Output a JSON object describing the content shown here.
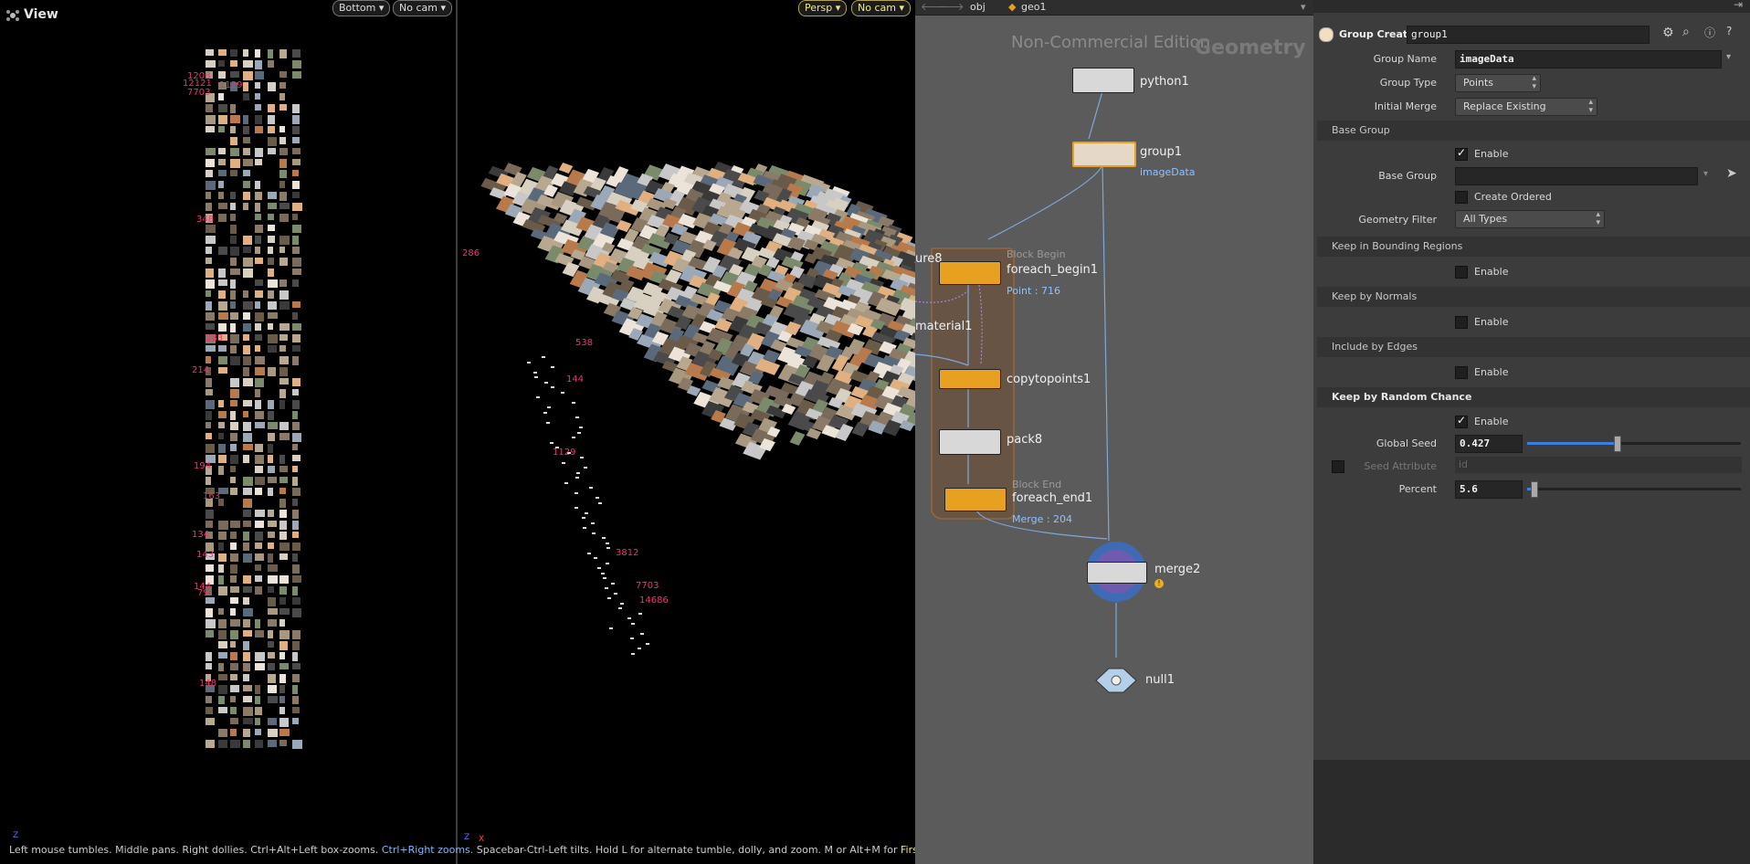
{
  "viewport": {
    "title": "View",
    "left_pane": {
      "view_menu": "Bottom",
      "cam_menu": "No cam"
    },
    "right_pane": {
      "view_menu": "Persp",
      "cam_menu": "No cam"
    },
    "left_labels": [
      "1208",
      "12121",
      "7703",
      "1129",
      "348",
      "283",
      "214",
      "194",
      "163",
      "134",
      "143",
      "144",
      "79",
      "148"
    ],
    "right_labels": [
      "286",
      "3812",
      "7703",
      "14686",
      "1129",
      "144",
      "538"
    ],
    "axis_left": "Z",
    "axis_right": "X",
    "hint": {
      "part1": "Left mouse tumbles. Middle pans. Right dollies. Ctrl+Alt+Left box-zooms. ",
      "part2": "Ctrl+Right zooms. ",
      "part3": "Spacebar-Ctrl-Left tilts. Hold L for alternate tumble, dolly, and zoom. M or Alt+M for ",
      "part4": "First Person Navigation."
    }
  },
  "network": {
    "path": [
      "obj",
      "geo1"
    ],
    "watermark_a": "Non-Commercial Edition",
    "watermark_b": "Geometry",
    "nodes": {
      "python1": {
        "name": "python1"
      },
      "group1": {
        "name": "group1",
        "sub": "imageData"
      },
      "foreach_begin1": {
        "header": "Block Begin",
        "name": "foreach_begin1",
        "sub": "Point : 716"
      },
      "copytopoints1": {
        "name": "copytopoints1"
      },
      "pack8": {
        "name": "pack8"
      },
      "foreach_end1": {
        "header": "Block End",
        "name": "foreach_end1",
        "sub": "Merge : 204"
      },
      "merge2": {
        "name": "merge2"
      },
      "null1": {
        "name": "null1"
      },
      "partial_a": {
        "name": "ure8"
      },
      "partial_b": {
        "name": "material1"
      }
    },
    "colors": {
      "orange": "#e8a020",
      "wire": "#7fa8d8",
      "block": "#8a5a2a"
    }
  },
  "params": {
    "node_type": "Group Create",
    "node_name": "group1",
    "group_name_label": "Group Name",
    "group_name_value": "imageData",
    "group_type_label": "Group Type",
    "group_type_value": "Points",
    "initial_merge_label": "Initial Merge",
    "initial_merge_value": "Replace Existing",
    "base_group_section": "Base Group",
    "enable_label": "Enable",
    "base_group_label": "Base Group",
    "create_ordered_label": "Create Ordered",
    "geometry_filter_label": "Geometry Filter",
    "geometry_filter_value": "All Types",
    "keep_bounding_section": "Keep in Bounding Regions",
    "keep_normals_section": "Keep by Normals",
    "include_edges_section": "Include by Edges",
    "random_section": "Keep by Random Chance",
    "global_seed_label": "Global Seed",
    "global_seed_value": "0.427",
    "global_seed_fraction": 0.42,
    "seed_attribute_label": "Seed Attribute",
    "seed_attribute_placeholder": "id",
    "percent_label": "Percent",
    "percent_value": "5.6",
    "percent_fraction": 0.03
  }
}
